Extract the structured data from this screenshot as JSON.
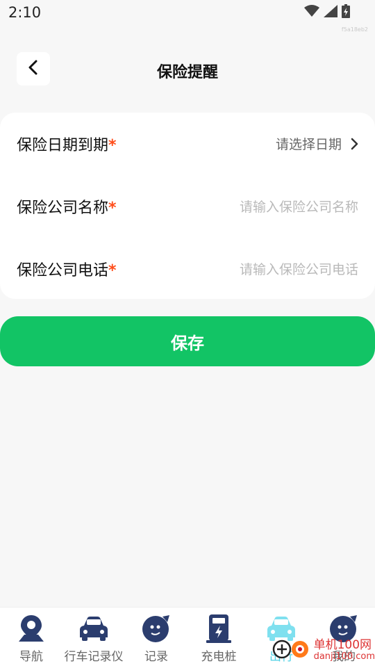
{
  "status_bar": {
    "time": "2:10",
    "tag": "f5a18eb2"
  },
  "header": {
    "title": "保险提醒"
  },
  "form": {
    "rows": [
      {
        "label": "保险日期到期",
        "required_mark": "*",
        "value": "请选择日期"
      },
      {
        "label": "保险公司名称",
        "required_mark": "*",
        "placeholder": "请输入保险公司名称"
      },
      {
        "label": "保险公司电话",
        "required_mark": "*",
        "placeholder": "请输入保险公司电话"
      }
    ]
  },
  "save_button": {
    "label": "保存"
  },
  "tabbar": {
    "items": [
      {
        "label": "导航",
        "icon": "location-pin-icon"
      },
      {
        "label": "行车记录仪",
        "icon": "car-icon"
      },
      {
        "label": "记录",
        "icon": "face-icon"
      },
      {
        "label": "充电桩",
        "icon": "charging-station-icon"
      },
      {
        "label": "出行",
        "icon": "car-icon",
        "active": true
      },
      {
        "label": "我的",
        "icon": "face-icon"
      }
    ]
  },
  "watermark": {
    "line1": "单机100网",
    "line2": "danji100.com"
  },
  "colors": {
    "accent": "#12c465",
    "required": "#ff4d1a",
    "tab_icon": "#2b3d6e",
    "tab_active": "#7fe0ef"
  }
}
